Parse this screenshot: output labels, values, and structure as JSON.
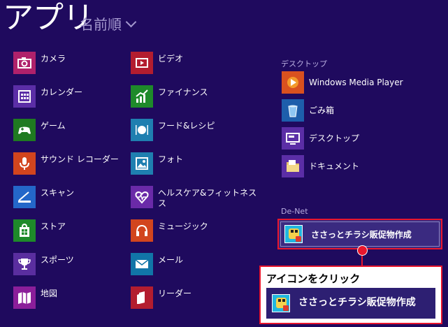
{
  "header": {
    "title": "アプリ",
    "sort_label": "名前順"
  },
  "col1": [
    {
      "label": "カメラ",
      "icon": "camera-icon",
      "color": "#b0216b"
    },
    {
      "label": "カレンダー",
      "icon": "calendar-icon",
      "color": "#5b2ea6"
    },
    {
      "label": "ゲーム",
      "icon": "gamepad-icon",
      "color": "#1f7a21"
    },
    {
      "label": "サウンド レコーダー",
      "icon": "microphone-icon",
      "color": "#d2451e"
    },
    {
      "label": "スキャン",
      "icon": "scanner-icon",
      "color": "#2467c9"
    },
    {
      "label": "ストア",
      "icon": "store-icon",
      "color": "#1e8a2a"
    },
    {
      "label": "スポーツ",
      "icon": "trophy-icon",
      "color": "#5a2e9f"
    },
    {
      "label": "地図",
      "icon": "map-icon",
      "color": "#8b1e9a"
    }
  ],
  "col2": [
    {
      "label": "ビデオ",
      "icon": "video-icon",
      "color": "#b31d2f"
    },
    {
      "label": "ファイナンス",
      "icon": "finance-chart-icon",
      "color": "#1e8a2a"
    },
    {
      "label": "フード&レシピ",
      "icon": "food-icon",
      "color": "#1f7fb0"
    },
    {
      "label": "フォト",
      "icon": "photo-icon",
      "color": "#1f7fb0"
    },
    {
      "label": "ヘルスケア&フィットネス",
      "label2": "ス",
      "icon": "heart-pulse-icon",
      "color": "#6a2aa8"
    },
    {
      "label": "ミュージック",
      "icon": "headphones-icon",
      "color": "#d2451e"
    },
    {
      "label": "メール",
      "icon": "mail-icon",
      "color": "#1175a8"
    },
    {
      "label": "リーダー",
      "icon": "reader-icon",
      "color": "#b31d2f"
    }
  ],
  "group_desktop": {
    "name": "デスクトップ",
    "items": [
      {
        "label": "Windows Media Player",
        "icon": "media-player-icon",
        "color": "#d9511f"
      },
      {
        "label": "ごみ箱",
        "icon": "recycle-bin-icon",
        "color": "#1d5eab"
      },
      {
        "label": "デスクトップ",
        "icon": "desktop-icon",
        "color": "#5b2ea6"
      },
      {
        "label": "ドキュメント",
        "icon": "documents-folder-icon",
        "color": "#5b2ea6"
      }
    ]
  },
  "group_denet": {
    "name": "De-Net",
    "items": [
      {
        "label": "ささっとチラシ販促物作成",
        "icon": "sasatto-app-icon",
        "color": "#21b7e0"
      }
    ]
  },
  "callout": {
    "title": "アイコンをクリック",
    "app_label": "ささっとチラシ販促物作成"
  },
  "colors": {
    "background": "#1f0a5e",
    "highlight": "#e8162d"
  }
}
